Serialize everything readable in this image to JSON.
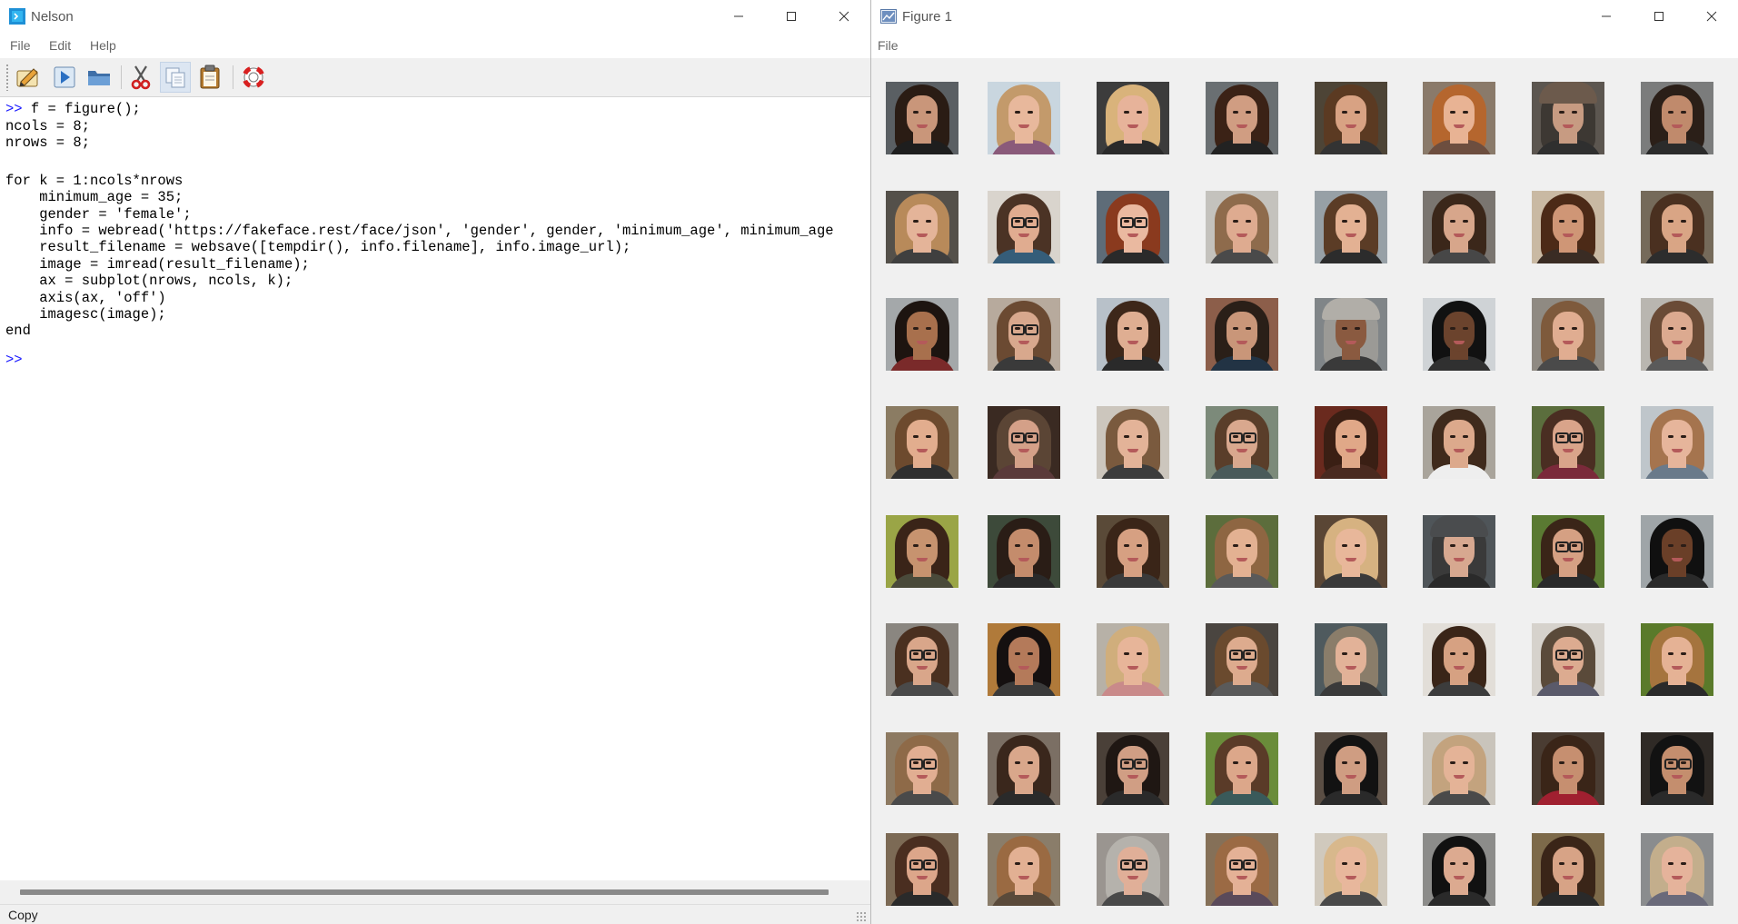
{
  "nelson": {
    "title": "Nelson",
    "menu": [
      "File",
      "Edit",
      "Help"
    ],
    "toolbar": [
      {
        "name": "editor-icon",
        "tip": "Editor"
      },
      {
        "name": "run-icon",
        "tip": "Run"
      },
      {
        "name": "open-folder-icon",
        "tip": "Open"
      },
      {
        "name": "cut-icon",
        "tip": "Cut"
      },
      {
        "name": "copy-icon",
        "tip": "Copy"
      },
      {
        "name": "paste-icon",
        "tip": "Paste"
      },
      {
        "name": "help-lifebuoy-icon",
        "tip": "Help"
      }
    ],
    "console": {
      "prompt": ">>",
      "lines": [
        {
          "prompt": ">>",
          "text": " f = figure();"
        },
        {
          "prompt": "",
          "text": "ncols = 8;"
        },
        {
          "prompt": "",
          "text": "nrows = 8;"
        },
        {
          "prompt": "",
          "text": ""
        },
        {
          "prompt": "",
          "text": ""
        },
        {
          "prompt": "",
          "text": "for k = 1:ncols*nrows"
        },
        {
          "prompt": "",
          "text": "    minimum_age = 35;"
        },
        {
          "prompt": "",
          "text": "    gender = 'female';"
        },
        {
          "prompt": "",
          "text": "    info = webread('https://fakeface.rest/face/json', 'gender', gender, 'minimum_age', minimum_age"
        },
        {
          "prompt": "",
          "text": "    result_filename = websave([tempdir(), info.filename], info.image_url);"
        },
        {
          "prompt": "",
          "text": "    image = imread(result_filename);"
        },
        {
          "prompt": "",
          "text": "    ax = subplot(nrows, ncols, k);"
        },
        {
          "prompt": "",
          "text": "    axis(ax, 'off')"
        },
        {
          "prompt": "",
          "text": "    imagesc(image);"
        },
        {
          "prompt": "",
          "text": "end"
        },
        {
          "prompt": "",
          "text": ""
        },
        {
          "prompt": ">>",
          "text": ""
        }
      ]
    },
    "status": "Copy",
    "colors": {
      "prompt": "#1a1aff",
      "chrome": "#f0f0f0"
    }
  },
  "figure": {
    "title": "Figure 1",
    "menu": [
      "File"
    ],
    "grid": {
      "rows": 8,
      "cols": 8
    },
    "faces": [
      {
        "bg": "#5a5f63",
        "hair": "#2a1c14",
        "skin": "#c9967a",
        "clothes": "#1e1e1e",
        "glasses": false,
        "hat": ""
      },
      {
        "bg": "#c9d6df",
        "hair": "#c39a6b",
        "skin": "#e8b89c",
        "clothes": "#8a5a7a",
        "glasses": false,
        "hat": ""
      },
      {
        "bg": "#3c3c3c",
        "hair": "#d9b37b",
        "skin": "#e7b39a",
        "clothes": "#2a2a2a",
        "glasses": false,
        "hat": ""
      },
      {
        "bg": "#6a6f72",
        "hair": "#3b2216",
        "skin": "#d09d82",
        "clothes": "#222222",
        "glasses": false,
        "hat": ""
      },
      {
        "bg": "#4d4436",
        "hair": "#5b3a22",
        "skin": "#d8a283",
        "clothes": "#333333",
        "glasses": false,
        "hat": ""
      },
      {
        "bg": "#8a7a6a",
        "hair": "#b5662e",
        "skin": "#e8b394",
        "clothes": "#6d4e3f",
        "glasses": false,
        "hat": ""
      },
      {
        "bg": "#5c5650",
        "hair": "#3d3833",
        "skin": "#c79b82",
        "clothes": "#2f2f2f",
        "glasses": false,
        "hat": "#6c5a4c"
      },
      {
        "bg": "#7b7c7c",
        "hair": "#2b1f18",
        "skin": "#c08a6c",
        "clothes": "#2b2b2b",
        "glasses": false,
        "hat": ""
      },
      {
        "bg": "#54504a",
        "hair": "#b88a5a",
        "skin": "#e4b499",
        "clothes": "#3f3f3f",
        "glasses": false,
        "hat": ""
      },
      {
        "bg": "#d9d4cd",
        "hair": "#4b3325",
        "skin": "#e0ac90",
        "clothes": "#355d79",
        "glasses": true,
        "hat": ""
      },
      {
        "bg": "#5e6c78",
        "hair": "#8a3a1e",
        "skin": "#eab9a0",
        "clothes": "#2a2a2a",
        "glasses": true,
        "hat": ""
      },
      {
        "bg": "#c4c2bd",
        "hair": "#8e6b4c",
        "skin": "#deab90",
        "clothes": "#4a4a4a",
        "glasses": false,
        "hat": ""
      },
      {
        "bg": "#97a0a6",
        "hair": "#5b3c26",
        "skin": "#e3b193",
        "clothes": "#2c2c2c",
        "glasses": false,
        "hat": ""
      },
      {
        "bg": "#7a7570",
        "hair": "#3b271a",
        "skin": "#d7a68b",
        "clothes": "#474747",
        "glasses": false,
        "hat": ""
      },
      {
        "bg": "#c9b9a3",
        "hair": "#4c2a17",
        "skin": "#cf9676",
        "clothes": "#3a2c24",
        "glasses": false,
        "hat": ""
      },
      {
        "bg": "#756a5a",
        "hair": "#4a3020",
        "skin": "#d9a585",
        "clothes": "#2d2d2d",
        "glasses": false,
        "hat": ""
      },
      {
        "bg": "#a4a8aa",
        "hair": "#1d1410",
        "skin": "#a8704d",
        "clothes": "#7a2a2a",
        "glasses": false,
        "hat": ""
      },
      {
        "bg": "#b7aa9d",
        "hair": "#6b4a32",
        "skin": "#d8a88d",
        "clothes": "#3a3a3a",
        "glasses": true,
        "hat": ""
      },
      {
        "bg": "#b8c1c9",
        "hair": "#3d271a",
        "skin": "#dfae92",
        "clothes": "#2a2a2a",
        "glasses": false,
        "hat": ""
      },
      {
        "bg": "#8c5e4a",
        "hair": "#2a1f18",
        "skin": "#c99679",
        "clothes": "#223344",
        "glasses": false,
        "hat": ""
      },
      {
        "bg": "#808588",
        "hair": "#9b9a96",
        "skin": "#8a5a40",
        "clothes": "#3a3a3a",
        "glasses": false,
        "hat": "#b1aea8"
      },
      {
        "bg": "#cfd3d6",
        "hair": "#111111",
        "skin": "#6b432d",
        "clothes": "#303030",
        "glasses": false,
        "hat": ""
      },
      {
        "bg": "#8f8a82",
        "hair": "#7e5a3c",
        "skin": "#e0ad91",
        "clothes": "#4a4a4a",
        "glasses": false,
        "hat": ""
      },
      {
        "bg": "#b9b6b0",
        "hair": "#6a4b36",
        "skin": "#dcaa90",
        "clothes": "#5a5a5a",
        "glasses": false,
        "hat": ""
      },
      {
        "bg": "#8b7c63",
        "hair": "#6d4a2e",
        "skin": "#e2ad8e",
        "clothes": "#2f2f2f",
        "glasses": false,
        "hat": ""
      },
      {
        "bg": "#3a2a22",
        "hair": "#5b4535",
        "skin": "#d4a088",
        "clothes": "#5a3a3a",
        "glasses": true,
        "hat": ""
      },
      {
        "bg": "#ccc6bd",
        "hair": "#7a5a3e",
        "skin": "#e3b398",
        "clothes": "#3c3c3c",
        "glasses": false,
        "hat": ""
      },
      {
        "bg": "#7c8a7a",
        "hair": "#5a3e2a",
        "skin": "#d9a88e",
        "clothes": "#4a5a5a",
        "glasses": true,
        "hat": ""
      },
      {
        "bg": "#6a2a1e",
        "hair": "#3a1f14",
        "skin": "#e0a888",
        "clothes": "#4a2a20",
        "glasses": false,
        "hat": ""
      },
      {
        "bg": "#a9a49b",
        "hair": "#3f2a1c",
        "skin": "#dca98c",
        "clothes": "#eeeeee",
        "glasses": false,
        "hat": ""
      },
      {
        "bg": "#5b6e3d",
        "hair": "#4a2e22",
        "skin": "#d9a48a",
        "clothes": "#7a2a3a",
        "glasses": true,
        "hat": ""
      },
      {
        "bg": "#bfc6cb",
        "hair": "#a5744e",
        "skin": "#e6b59b",
        "clothes": "#6a7a8a",
        "glasses": false,
        "hat": ""
      },
      {
        "bg": "#9aa546",
        "hair": "#3a2418",
        "skin": "#c7936f",
        "clothes": "#4a4a3a",
        "glasses": false,
        "hat": ""
      },
      {
        "bg": "#3d4a3a",
        "hair": "#2a1d16",
        "skin": "#c48c6c",
        "clothes": "#2a2a2a",
        "glasses": false,
        "hat": ""
      },
      {
        "bg": "#5a4a38",
        "hair": "#3a2518",
        "skin": "#d6a082",
        "clothes": "#3a3a3a",
        "glasses": false,
        "hat": ""
      },
      {
        "bg": "#5c6d3c",
        "hair": "#8e6642",
        "skin": "#e3b192",
        "clothes": "#5a5a5a",
        "glasses": false,
        "hat": ""
      },
      {
        "bg": "#5a4635",
        "hair": "#d6b281",
        "skin": "#e8b79a",
        "clothes": "#3a3a3a",
        "glasses": false,
        "hat": ""
      },
      {
        "bg": "#4f5559",
        "hair": "#3a3a3a",
        "skin": "#d7a890",
        "clothes": "#2a2a2a",
        "glasses": false,
        "hat": "#4a4c4e"
      },
      {
        "bg": "#5a7a32",
        "hair": "#3a2518",
        "skin": "#d5a083",
        "clothes": "#2a2a2a",
        "glasses": true,
        "hat": ""
      },
      {
        "bg": "#9fa5a8",
        "hair": "#101010",
        "skin": "#6a3f28",
        "clothes": "#2a2a2a",
        "glasses": false,
        "hat": ""
      },
      {
        "bg": "#8a8680",
        "hair": "#4a3020",
        "skin": "#d9a68a",
        "clothes": "#4a4a4a",
        "glasses": true,
        "hat": ""
      },
      {
        "bg": "#b07a3a",
        "hair": "#151010",
        "skin": "#b47a5a",
        "clothes": "#3a3a3a",
        "glasses": false,
        "hat": ""
      },
      {
        "bg": "#b7b1a7",
        "hair": "#d0ae7c",
        "skin": "#e7b599",
        "clothes": "#c98a8a",
        "glasses": false,
        "hat": ""
      },
      {
        "bg": "#4a4540",
        "hair": "#6a4a2e",
        "skin": "#ddab8e",
        "clothes": "#5a5a5a",
        "glasses": true,
        "hat": ""
      },
      {
        "bg": "#4f5a5e",
        "hair": "#8a7d6a",
        "skin": "#e2b298",
        "clothes": "#3a3a3a",
        "glasses": false,
        "hat": ""
      },
      {
        "bg": "#e2ded8",
        "hair": "#3a2518",
        "skin": "#d6a182",
        "clothes": "#3c3c3c",
        "glasses": false,
        "hat": ""
      },
      {
        "bg": "#d6d2cc",
        "hair": "#5a4a3a",
        "skin": "#dcab90",
        "clothes": "#5a5a6a",
        "glasses": true,
        "hat": ""
      },
      {
        "bg": "#5a7a2a",
        "hair": "#a5743e",
        "skin": "#e5b295",
        "clothes": "#2a2a2a",
        "glasses": false,
        "hat": ""
      },
      {
        "bg": "#8d7a62",
        "hair": "#8e6a48",
        "skin": "#e1ae92",
        "clothes": "#4a4a4a",
        "glasses": true,
        "hat": ""
      },
      {
        "bg": "#7b6f64",
        "hair": "#3a271c",
        "skin": "#d9a78b",
        "clothes": "#2a2a2a",
        "glasses": false,
        "hat": ""
      },
      {
        "bg": "#4a4038",
        "hair": "#1f1713",
        "skin": "#d09e84",
        "clothes": "#2a2a2a",
        "glasses": true,
        "hat": ""
      },
      {
        "bg": "#6a8c3a",
        "hair": "#5a3b28",
        "skin": "#dca78a",
        "clothes": "#3a5a5a",
        "glasses": false,
        "hat": ""
      },
      {
        "bg": "#5a4e44",
        "hair": "#121212",
        "skin": "#cf9d82",
        "clothes": "#2a2a2a",
        "glasses": false,
        "hat": ""
      },
      {
        "bg": "#c9c4bb",
        "hair": "#c3a37e",
        "skin": "#e4b397",
        "clothes": "#4a4a4a",
        "glasses": false,
        "hat": ""
      },
      {
        "bg": "#4a3c32",
        "hair": "#3a2518",
        "skin": "#c68f70",
        "clothes": "#a02030",
        "glasses": false,
        "hat": ""
      },
      {
        "bg": "#2f2a26",
        "hair": "#121212",
        "skin": "#c48e6e",
        "clothes": "#2a2a2a",
        "glasses": true,
        "hat": ""
      },
      {
        "bg": "#7c6a55",
        "hair": "#4a2e20",
        "skin": "#dca68a",
        "clothes": "#2a2a2a",
        "glasses": true,
        "hat": ""
      },
      {
        "bg": "#8a7d6a",
        "hair": "#9a6a42",
        "skin": "#e2b093",
        "clothes": "#5a4a3a",
        "glasses": false,
        "hat": ""
      },
      {
        "bg": "#9a9590",
        "hair": "#b5b2ac",
        "skin": "#e0af98",
        "clothes": "#4a4a4a",
        "glasses": true,
        "hat": ""
      },
      {
        "bg": "#857058",
        "hair": "#9b6a44",
        "skin": "#e4b196",
        "clothes": "#5a4a5a",
        "glasses": true,
        "hat": ""
      },
      {
        "bg": "#d0c9bd",
        "hair": "#d8b88c",
        "skin": "#e8b79c",
        "clothes": "#4a4a4a",
        "glasses": false,
        "hat": ""
      },
      {
        "bg": "#8c8c8a",
        "hair": "#111111",
        "skin": "#dcaa90",
        "clothes": "#2a2a2a",
        "glasses": false,
        "hat": ""
      },
      {
        "bg": "#7d6a4a",
        "hair": "#3a2518",
        "skin": "#d7a386",
        "clothes": "#2a2a2a",
        "glasses": false,
        "hat": ""
      },
      {
        "bg": "#8a8c8e",
        "hair": "#c3ae8c",
        "skin": "#e5b39b",
        "clothes": "#6a6a7a",
        "glasses": false,
        "hat": ""
      }
    ]
  }
}
